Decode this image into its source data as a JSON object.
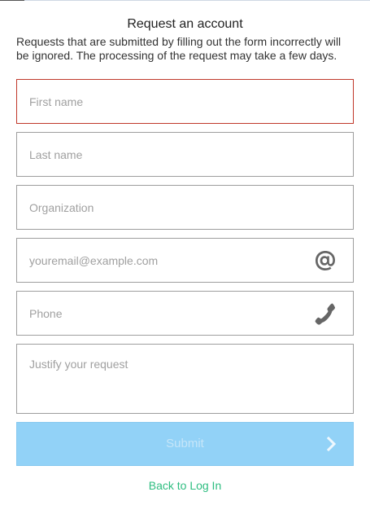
{
  "form": {
    "title": "Request an account",
    "description": "Requests that are submitted by filling out the form incorrectly will be ignored. The processing of the request may take a few days.",
    "first_name": {
      "placeholder": "First name",
      "value": ""
    },
    "last_name": {
      "placeholder": "Last name",
      "value": ""
    },
    "organization": {
      "placeholder": "Organization",
      "value": ""
    },
    "email": {
      "placeholder": "youremail@example.com",
      "value": "",
      "icon": "at-sign-icon"
    },
    "phone": {
      "placeholder": "Phone",
      "value": "",
      "icon": "phone-icon"
    },
    "justification": {
      "placeholder": "Justify your request",
      "value": ""
    },
    "submit_label": "Submit",
    "back_link": "Back to Log In"
  },
  "colors": {
    "error_border": "#c0392b",
    "submit_bg": "#92d2f7",
    "link": "#2ebd80",
    "icon": "#666666"
  }
}
